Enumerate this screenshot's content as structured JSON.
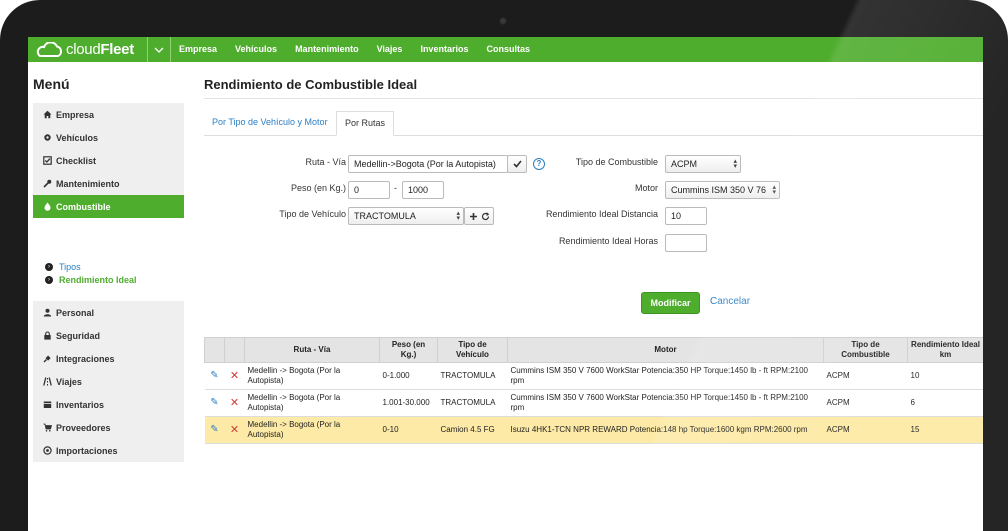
{
  "brand": {
    "name_light": "cloud",
    "name_bold": "Fleet",
    "accent": "#4fad2e"
  },
  "topnav": [
    "Empresa",
    "Vehículos",
    "Mantenimiento",
    "Viajes",
    "Inventarios",
    "Consultas"
  ],
  "sidebar": {
    "title": "Menú",
    "items_top": [
      {
        "label": "Empresa",
        "icon": "home-icon"
      },
      {
        "label": "Vehículos",
        "icon": "gear-icon"
      },
      {
        "label": "Checklist",
        "icon": "checkbox-icon"
      },
      {
        "label": "Mantenimiento",
        "icon": "wrench-icon"
      },
      {
        "label": "Combustible",
        "icon": "drop-icon"
      }
    ],
    "subitems": [
      "Tipos",
      "Rendimiento Ideal"
    ],
    "items_bottom": [
      {
        "label": "Personal",
        "icon": "user-icon"
      },
      {
        "label": "Seguridad",
        "icon": "lock-icon"
      },
      {
        "label": "Integraciones",
        "icon": "plug-icon"
      },
      {
        "label": "Viajes",
        "icon": "road-icon"
      },
      {
        "label": "Inventarios",
        "icon": "box-icon"
      },
      {
        "label": "Proveedores",
        "icon": "cart-icon"
      },
      {
        "label": "Importaciones",
        "icon": "import-icon"
      }
    ]
  },
  "page": {
    "title": "Rendimiento de Combustible Ideal"
  },
  "tabs": [
    "Por Tipo de Vehículo y Motor",
    "Por Rutas"
  ],
  "form": {
    "ruta_label": "Ruta - Vía",
    "ruta_value": "Medellin->Bogota (Por la Autopista)",
    "peso_label": "Peso (en Kg.)",
    "peso_min": "0",
    "peso_sep": "-",
    "peso_max": "1000",
    "tipo_vehiculo_label": "Tipo de Vehículo",
    "tipo_vehiculo_value": "TRACTOMULA",
    "combustible_label": "Tipo de Combustible",
    "combustible_value": "ACPM",
    "motor_label": "Motor",
    "motor_value": "Cummins ISM 350 V 76",
    "distancia_label": "Rendimiento Ideal Distancia",
    "distancia_value": "10",
    "horas_label": "Rendimiento Ideal Horas",
    "horas_value": "",
    "save_label": "Modificar",
    "cancel_label": "Cancelar"
  },
  "table": {
    "headers": [
      "Ruta - Vía",
      "Peso (en Kg.)",
      "Tipo de Vehículo",
      "Motor",
      "Tipo de Combustible",
      "Rendimiento Ideal km"
    ],
    "rows": [
      {
        "ruta": "Medellin -> Bogota (Por la Autopista)",
        "peso": "0-1.000",
        "tipo": "TRACTOMULA",
        "motor": "Cummins ISM 350 V 7600 WorkStar Potencia:350 HP Torque:1450 lb - ft RPM:2100 rpm",
        "combustible": "ACPM",
        "rendimiento": "10"
      },
      {
        "ruta": "Medellin -> Bogota (Por la Autopista)",
        "peso": "1.001-30.000",
        "tipo": "TRACTOMULA",
        "motor": "Cummins ISM 350 V 7600 WorkStar Potencia:350 HP Torque:1450 lb - ft RPM:2100 rpm",
        "combustible": "ACPM",
        "rendimiento": "6"
      },
      {
        "ruta": "Medellin -> Bogota (Por la Autopista)",
        "peso": "0-10",
        "tipo": "Camion 4.5 FG",
        "motor": "Isuzu 4HK1-TCN NPR REWARD Potencia:148 hp Torque:1600 kgm RPM:2600 rpm",
        "combustible": "ACPM",
        "rendimiento": "15"
      }
    ]
  }
}
